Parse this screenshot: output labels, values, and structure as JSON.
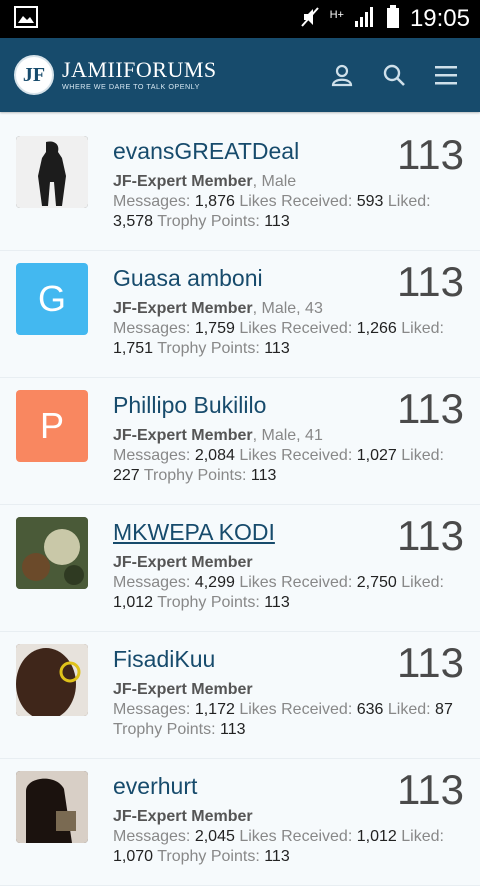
{
  "status_bar": {
    "time": "19:05",
    "network": "H+"
  },
  "app": {
    "brand": "JAMIIFORUMS",
    "tagline": "WHERE WE DARE TO TALK OPENLY",
    "logo_mark": "JF"
  },
  "labels": {
    "messages": "Messages:",
    "likes_received": "Likes Received:",
    "liked": "Liked:",
    "trophy_points": "Trophy Points:"
  },
  "members": [
    {
      "name": "evansGREATDeal",
      "title": "JF-Expert Member",
      "details": ", Male",
      "count": "113",
      "messages": "1,876",
      "likes_received": "593",
      "liked": "3,578",
      "trophy_points": "113",
      "avatar_letter": "",
      "avatar_color": "#2a2a2a"
    },
    {
      "name": "Guasa amboni",
      "title": "JF-Expert Member",
      "details": ", Male, 43",
      "count": "113",
      "messages": "1,759",
      "likes_received": "1,266",
      "liked": "1,751",
      "trophy_points": "113",
      "avatar_letter": "G",
      "avatar_color": "#43b8f0"
    },
    {
      "name": "Phillipo Bukililo",
      "title": "JF-Expert Member",
      "details": ", Male, 41",
      "count": "113",
      "messages": "2,084",
      "likes_received": "1,027",
      "liked": "227",
      "trophy_points": "113",
      "avatar_letter": "P",
      "avatar_color": "#f98760"
    },
    {
      "name": "MKWEPA KODI",
      "title": "JF-Expert Member",
      "details": "",
      "count": "113",
      "messages": "4,299",
      "likes_received": "2,750",
      "liked": "1,012",
      "trophy_points": "113",
      "avatar_letter": "",
      "avatar_color": "#5b6a45"
    },
    {
      "name": "FisadiKuu",
      "title": "JF-Expert Member",
      "details": "",
      "count": "113",
      "messages": "1,172",
      "likes_received": "636",
      "liked": "87",
      "trophy_points": "113",
      "avatar_letter": "",
      "avatar_color": "#5c3b2a"
    },
    {
      "name": "everhurt",
      "title": "JF-Expert Member",
      "details": "",
      "count": "113",
      "messages": "2,045",
      "likes_received": "1,012",
      "liked": "1,070",
      "trophy_points": "113",
      "avatar_letter": "",
      "avatar_color": "#2a1e18"
    }
  ]
}
